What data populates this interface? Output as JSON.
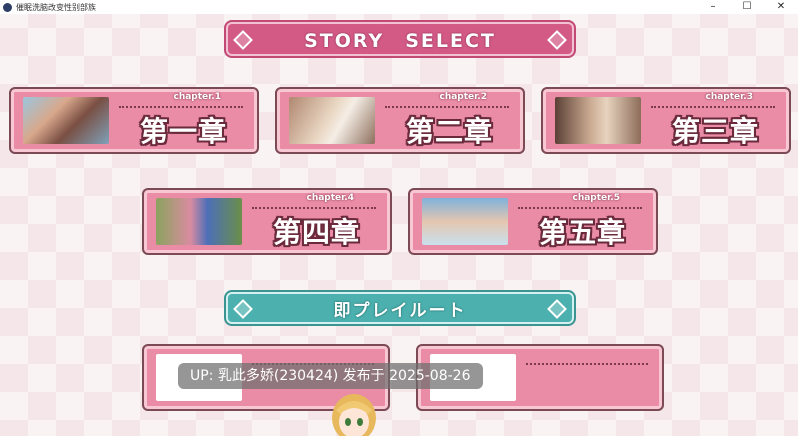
{
  "window": {
    "title": "催眠洗脑改变性别部族",
    "controls": [
      "–",
      "☐",
      "✕"
    ]
  },
  "story_banner": "STORY　SELECT",
  "route_banner": "即プレイルート",
  "chapters": [
    {
      "label": "chapter.1",
      "name": "第一章"
    },
    {
      "label": "chapter.2",
      "name": "第二章"
    },
    {
      "label": "chapter.3",
      "name": "第三章"
    },
    {
      "label": "chapter.4",
      "name": "第四章"
    },
    {
      "label": "chapter.5",
      "name": "第五章"
    }
  ],
  "overlay_text": "UP: 乳此多娇(230424) 发布于 2025-08-26",
  "colors": {
    "pink_banner": "#d45a86",
    "teal_banner": "#4bb0ae",
    "card_pink": "#ea8ca6",
    "card_border": "#7c4a55"
  }
}
